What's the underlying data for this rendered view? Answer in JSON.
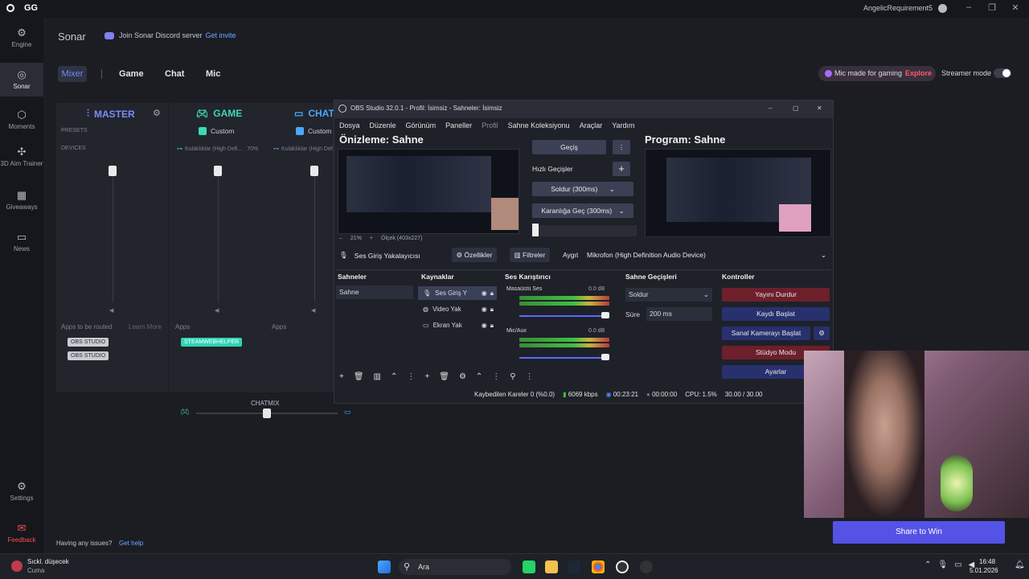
{
  "titlebar": {
    "app": "GG",
    "user": "AngelicRequirement5"
  },
  "sidebar": {
    "items": [
      {
        "label": "Engine",
        "icon": "gear-engine-icon"
      },
      {
        "label": "Sonar",
        "icon": "sonar-icon"
      },
      {
        "label": "Moments",
        "icon": "moments-icon"
      },
      {
        "label": "3D Aim Trainer",
        "icon": "aim-icon"
      },
      {
        "label": "Giveaways",
        "icon": "gift-icon"
      },
      {
        "label": "News",
        "icon": "news-icon"
      },
      {
        "label": "Settings",
        "icon": "settings-icon"
      },
      {
        "label": "Feedback",
        "icon": "feedback-icon"
      }
    ]
  },
  "sonar": {
    "title": "Sonar",
    "discord_text": "Join Sonar Discord server",
    "discord_link": "Get invite"
  },
  "tabs": {
    "mixer": "Mixer",
    "game": "Game",
    "chat": "Chat",
    "mic": "Mic"
  },
  "promo": {
    "text": "Mic made for gaming",
    "link": "Explore",
    "streamer": "Streamer mode"
  },
  "mixer": {
    "master": "MASTER",
    "game": "GAME",
    "chat": "CHAT",
    "presets": "PRESETS",
    "devices": "DEVICES",
    "game_preset": "Custom",
    "chat_preset": "Custom",
    "game_device": "Kulaklıklar (High Defi...",
    "game_pct": "70%",
    "chat_device": "Kulaklıklar (High Def...",
    "apps_routed": "Apps to be routed",
    "learn_more": "Learn More",
    "apps1": "Apps",
    "apps2": "Apps",
    "obs1": "OBS STUDIO",
    "obs2": "OBS STUDIO",
    "helper": "STEAMWEBHELPER",
    "chatmix": "CHATMIX",
    "chatmix_value": 0.5
  },
  "help": {
    "text": "Having any issues?",
    "link": "Get help"
  },
  "obs": {
    "title": "OBS Studio 32.0.1 - Profil: İsimsiz - Sahneler: İsimsiz",
    "menu": [
      "Dosya",
      "Düzenle",
      "Görünüm",
      "Paneller",
      "Profil",
      "Sahne Koleksiyonu",
      "Araçlar",
      "Yardım"
    ],
    "preview": "Önizleme: Sahne",
    "program": "Program: Sahne",
    "gecis": "Geçiş",
    "hizli": "Hızlı Geçişler",
    "soldur": "Soldur (300ms)",
    "karanlik": "Karanlığa Geç (300ms)",
    "zoom": "21%",
    "canvas": "Ölçek (403x227)",
    "source_label": "Ses Giriş Yakalayıcısı",
    "props": "Özellikler",
    "filters": "Filtreler",
    "device_lbl": "Aygıt",
    "device": "Mikrofon (High Definition Audio Device)",
    "scenes_h": "Sahneler",
    "scene1": "Sahne",
    "sources_h": "Kaynaklar",
    "src1": "Ses Giriş Y",
    "src2": "Video Yak",
    "src3": "Ekran Yak",
    "mixer_h": "Ses Karıştırıcı",
    "desk": "Masaüstü Ses",
    "desk_db": "0.0 dB",
    "mic": "Mic/Aux",
    "mic_db": "0.0 dB",
    "trans_h": "Sahne Geçişleri",
    "trans_sel": "Soldur",
    "dur_lbl": "Süre",
    "dur": "200 ms",
    "ctrl_h": "Kontroller",
    "stop": "Yayını Durdur",
    "rec": "Kaydı Başlat",
    "vcam": "Sanal Kamerayı Başlat",
    "studio": "Stüdyo Modu",
    "settings": "Ayarlar",
    "status_dropped": "Kaybedilen Kareler 0 (%0.0)",
    "status_kbps": "6069 kbps",
    "status_live": "00:23:21",
    "status_rec": "00:00:00",
    "status_cpu": "CPU: 1.5%",
    "status_fps": "30.00 / 30.00"
  },
  "share": "Share to Win",
  "taskbar": {
    "weather_title": "Sıckl. düşecek",
    "weather_sub": "Cuma",
    "search": "Ara",
    "time": "16:48",
    "date": "5.01.2026"
  }
}
